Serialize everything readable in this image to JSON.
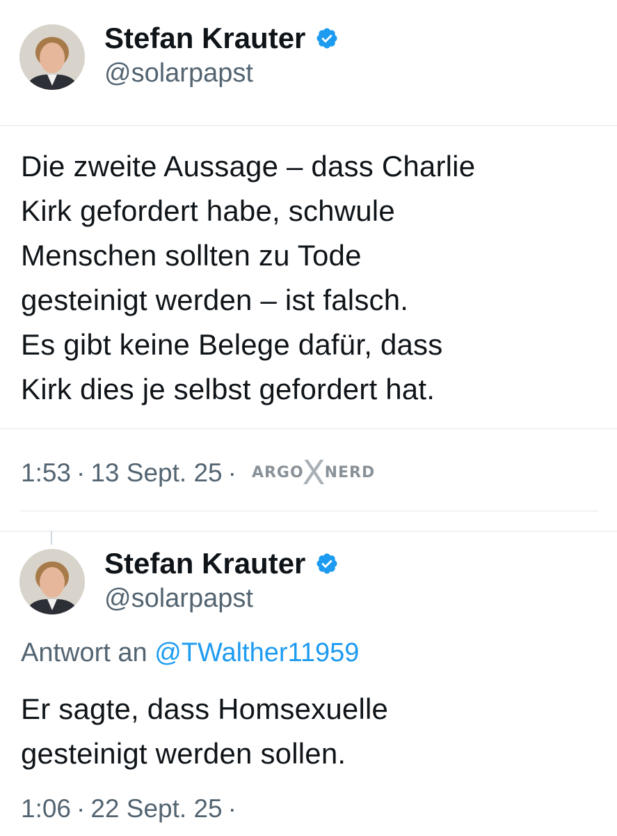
{
  "tweet1": {
    "display_name": "Stefan Krauter",
    "handle": "@solarpapst",
    "verified": true,
    "avatar_icon": "profile-photo",
    "text": "Die zweite Aussage – dass Charlie\nKirk gefordert habe, schwule\nMenschen sollten zu Tode\ngesteinigt werden – ist falsch.\nEs gibt keine Belege dafür, dass\nKirk dies je selbst gefordert hat.",
    "time": "1:53",
    "date": "13 Sept. 25",
    "separator": "·",
    "watermark": {
      "left": "ARGO",
      "mid": "X",
      "right": "NERD"
    }
  },
  "tweet2": {
    "display_name": "Stefan Krauter",
    "handle": "@solarpapst",
    "verified": true,
    "avatar_icon": "profile-photo",
    "reply_prefix": "Antwort an",
    "reply_to": "@TWalther11959",
    "text": "Er sagte, dass Homsexuelle\ngesteinigt werden sollen.",
    "time": "1:06",
    "date": "22 Sept. 25",
    "separator": "·"
  },
  "colors": {
    "text": "#0f1419",
    "secondary": "#536471",
    "link": "#1d9bf0",
    "verified": "#1d9bf0",
    "divider": "#e3e6e9"
  }
}
